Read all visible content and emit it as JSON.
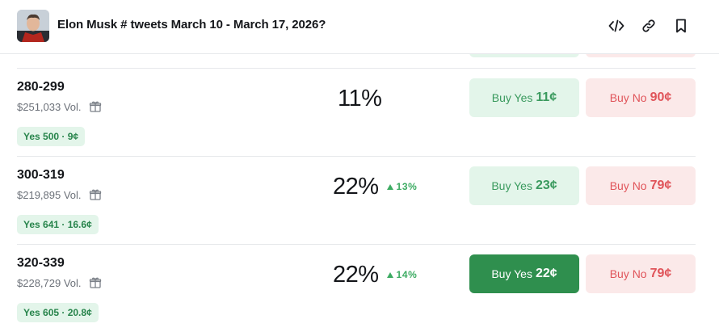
{
  "header": {
    "title": "Elon Musk # tweets March 10 - March 17, 2026?",
    "icons": [
      "embed-code-icon",
      "link-icon",
      "bookmark-icon"
    ]
  },
  "colors": {
    "yes_bg": "#e3f5ea",
    "yes_text": "#3a9a5e",
    "yes_active_bg": "#2f8f4e",
    "no_bg": "#fbe9e9",
    "no_text": "#e0545a",
    "up": "#3cab62"
  },
  "buttons": {
    "yes_label": "Buy Yes",
    "no_label": "Buy No"
  },
  "rows": [
    {
      "range": "280-299",
      "volume": "$251,033 Vol.",
      "pill": "Yes 500 · 9¢",
      "percent": "11%",
      "change": "",
      "yes_price": "11¢",
      "no_price": "90¢"
    },
    {
      "range": "300-319",
      "volume": "$219,895 Vol.",
      "pill": "Yes 641 · 16.6¢",
      "percent": "22%",
      "change": "13%",
      "yes_price": "23¢",
      "no_price": "79¢"
    },
    {
      "range": "320-339",
      "volume": "$228,729 Vol.",
      "pill": "Yes 605 · 20.8¢",
      "percent": "22%",
      "change": "14%",
      "yes_price": "22¢",
      "no_price": "79¢"
    }
  ]
}
